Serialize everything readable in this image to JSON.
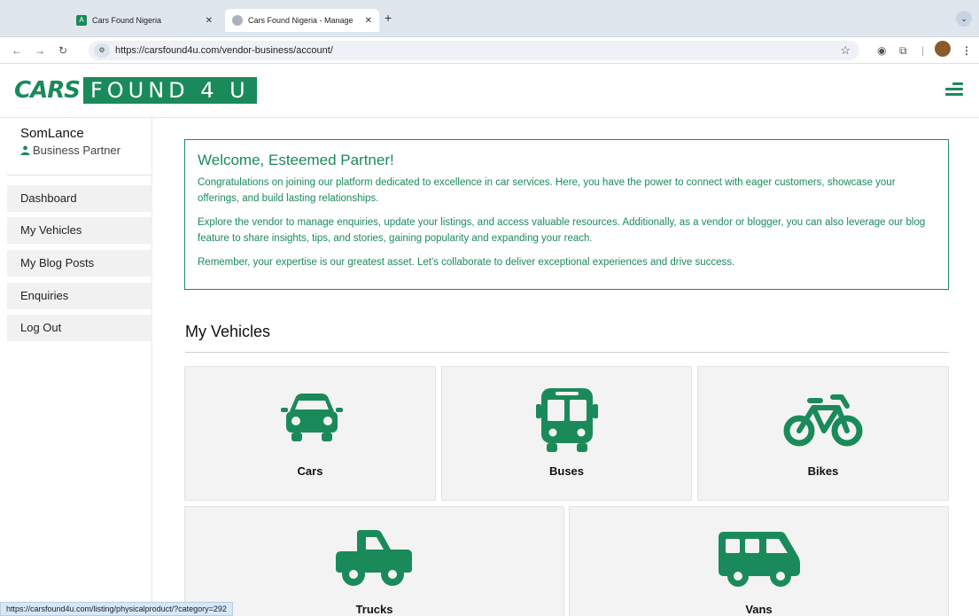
{
  "browser": {
    "tabs": [
      {
        "title": "Cars Found Nigeria"
      },
      {
        "title": "Cars Found Nigeria - Manage"
      }
    ],
    "url": "https://carsfound4u.com/vendor-business/account/",
    "status_url": "https://carsfound4u.com/listing/physicalproduct/?category=292"
  },
  "header": {
    "logo_left": "CARS",
    "logo_right": "FOUND 4 U"
  },
  "sidebar": {
    "username": "SomLance",
    "role": "Business Partner",
    "items": [
      {
        "label": "Dashboard"
      },
      {
        "label": "My Vehicles"
      },
      {
        "label": "My Blog Posts"
      },
      {
        "label": "Enquiries"
      },
      {
        "label": "Log Out"
      }
    ]
  },
  "welcome": {
    "title": "Welcome, Esteemed Partner!",
    "paragraphs": [
      "Congratulations on joining our platform dedicated to excellence in car services. Here, you have the power to connect with eager customers, showcase your offerings, and build lasting relationships.",
      "Explore the vendor to manage enquiries, update your listings, and access valuable resources. Additionally, as a vendor or blogger, you can also leverage our blog feature to share insights, tips, and stories, gaining popularity and expanding your reach.",
      "Remember, your expertise is our greatest asset. Let's collaborate to deliver exceptional experiences and drive success."
    ]
  },
  "vehicles": {
    "title": "My Vehicles",
    "categories": [
      {
        "label": "Cars",
        "icon": "car-icon"
      },
      {
        "label": "Buses",
        "icon": "bus-icon"
      },
      {
        "label": "Bikes",
        "icon": "bike-icon"
      },
      {
        "label": "Trucks",
        "icon": "truck-icon"
      },
      {
        "label": "Vans",
        "icon": "van-icon"
      }
    ]
  },
  "colors": {
    "brand": "#1b8a5a"
  }
}
